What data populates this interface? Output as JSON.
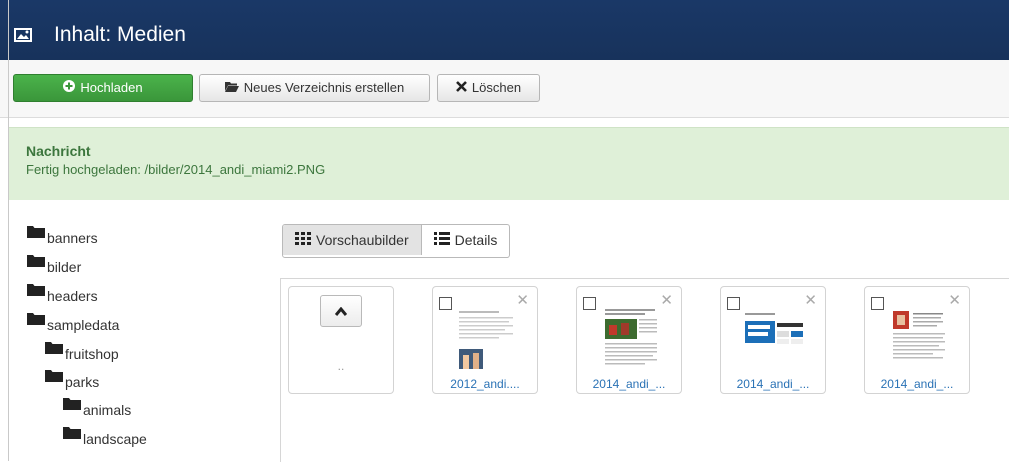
{
  "header": {
    "title": "Inhalt: Medien",
    "icon": "image-icon"
  },
  "toolbar": {
    "upload_label": "Hochladen",
    "new_folder_label": "Neues Verzeichnis erstellen",
    "delete_label": "Löschen",
    "colors": {
      "upload": "#3d9c3d"
    }
  },
  "message": {
    "heading": "Nachricht",
    "text": "Fertig hochgeladen: /bilder/2014_andi_miami2.PNG",
    "color": "#dff0d8"
  },
  "folder_tree": [
    {
      "label": "banners",
      "depth": 0
    },
    {
      "label": "bilder",
      "depth": 0
    },
    {
      "label": "headers",
      "depth": 0
    },
    {
      "label": "sampledata",
      "depth": 0
    },
    {
      "label": "fruitshop",
      "depth": 1
    },
    {
      "label": "parks",
      "depth": 1
    },
    {
      "label": "animals",
      "depth": 2
    },
    {
      "label": "landscape",
      "depth": 2
    }
  ],
  "view_toggle": {
    "thumbnails_label": "Vorschaubilder",
    "details_label": "Details",
    "active": "thumbnails"
  },
  "thumbnails": {
    "up_label": "..",
    "items": [
      {
        "name": "2012_andi...."
      },
      {
        "name": "2014_andi_..."
      },
      {
        "name": "2014_andi_..."
      },
      {
        "name": "2014_andi_..."
      }
    ]
  }
}
